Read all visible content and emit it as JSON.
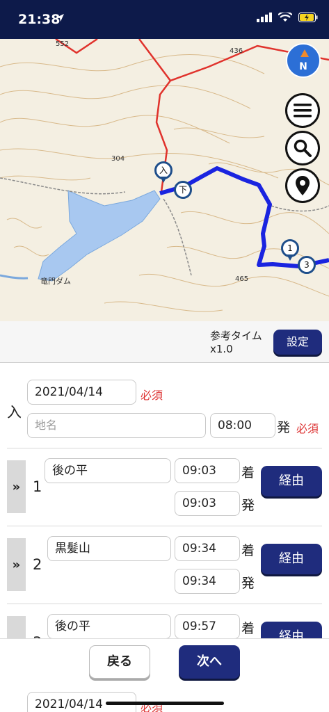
{
  "status": {
    "time": "21:38"
  },
  "map": {
    "compass_label": "N",
    "dam_label": "竜門ダム",
    "height_labels": [
      "552",
      "436",
      "304",
      "465"
    ],
    "markers": {
      "entry": "入",
      "descend": "下",
      "wp1": "1",
      "wp3": "3"
    }
  },
  "reftime": {
    "label_line1": "参考タイム",
    "label_line2": "x1.0",
    "settings_button": "設定"
  },
  "entry": {
    "side_label": "入",
    "date": "2021/04/14",
    "date_required": "必須",
    "place_placeholder": "地名",
    "time": "08:00",
    "depart_label": "発",
    "time_required": "必須"
  },
  "waypoints": [
    {
      "number": "1",
      "name": "後の平",
      "arrive": "09:03",
      "depart": "09:03",
      "arrive_label": "着",
      "depart_label": "発",
      "button": "経由"
    },
    {
      "number": "2",
      "name": "黒髪山",
      "arrive": "09:34",
      "depart": "09:34",
      "arrive_label": "着",
      "depart_label": "発",
      "button": "経由"
    },
    {
      "number": "3",
      "name": "後の平",
      "arrive": "09:57",
      "arrive_label": "着",
      "button": "経由"
    }
  ],
  "footer": {
    "back_button": "戻る",
    "next_button": "次へ",
    "peek_date": "2021/04/14",
    "peek_required": "必須"
  }
}
